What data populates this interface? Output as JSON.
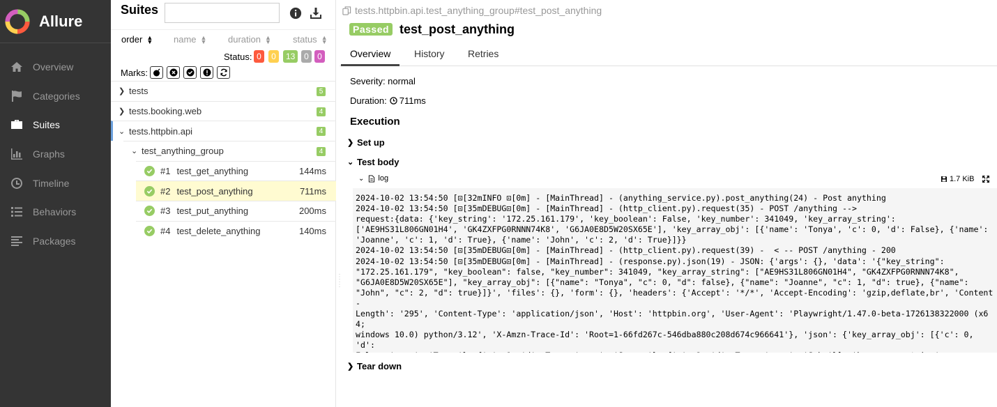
{
  "app": {
    "name": "Allure"
  },
  "nav": [
    {
      "label": "Overview",
      "icon": "home-icon"
    },
    {
      "label": "Categories",
      "icon": "flag-icon"
    },
    {
      "label": "Suites",
      "icon": "briefcase-icon",
      "active": true
    },
    {
      "label": "Graphs",
      "icon": "bar-chart-icon"
    },
    {
      "label": "Timeline",
      "icon": "clock-icon"
    },
    {
      "label": "Behaviors",
      "icon": "list-icon"
    },
    {
      "label": "Packages",
      "icon": "align-left-icon"
    }
  ],
  "tree": {
    "title": "Suites",
    "search": {
      "value": "",
      "placeholder": ""
    },
    "sort": {
      "order": "order",
      "name": "name",
      "duration": "duration",
      "status": "status"
    },
    "status_label": "Status:",
    "status_counts": [
      {
        "value": "0",
        "color": "#fd5a3e"
      },
      {
        "value": "0",
        "color": "#ffd050"
      },
      {
        "value": "13",
        "color": "#97cc64"
      },
      {
        "value": "0",
        "color": "#aaaaaa"
      },
      {
        "value": "0",
        "color": "#d35ebe"
      }
    ],
    "marks_label": "Marks:",
    "marks": [
      "bomb-icon",
      "times-circle-icon",
      "check-circle-icon",
      "info-circle-icon",
      "refresh-icon"
    ],
    "suites": [
      {
        "name": "tests",
        "count": "5"
      },
      {
        "name": "tests.booking.web",
        "count": "4"
      },
      {
        "name": "tests.httpbin.api",
        "count": "4"
      }
    ],
    "group": {
      "name": "test_anything_group",
      "count": "4"
    },
    "tests": [
      {
        "num": "#1",
        "name": "test_get_anything",
        "duration": "144ms"
      },
      {
        "num": "#2",
        "name": "test_post_anything",
        "duration": "711ms"
      },
      {
        "num": "#3",
        "name": "test_put_anything",
        "duration": "200ms"
      },
      {
        "num": "#4",
        "name": "test_delete_anything",
        "duration": "140ms"
      }
    ]
  },
  "detail": {
    "breadcrumb": "tests.httpbin.api.test_anything_group#test_post_anything",
    "status": "Passed",
    "title": "test_post_anything",
    "tabs": [
      "Overview",
      "History",
      "Retries"
    ],
    "severity": "Severity: normal",
    "duration_label": "Duration:",
    "duration_value": "711ms",
    "execution_title": "Execution",
    "setup": "Set up",
    "test_body": "Test body",
    "teardown": "Tear down",
    "log_name": "log",
    "log_size": "1.7 KiB",
    "log_text": "2024-10-02 13:54:50 [⊡[32mINFO ⊡[0m] - [MainThread] - (anything_service.py).post_anything(24) - Post anything\n2024-10-02 13:54:50 [⊡[35mDEBUG⊡[0m] - [MainThread] - (http_client.py).request(35) - POST /anything -->\nrequest:{data: {'key_string': '172.25.161.179', 'key_boolean': False, 'key_number': 341049, 'key_array_string':\n['AE9HS31L806GN01H4', 'GK4ZXFPG0RNNN74K8', 'G6JA0E8D5W20SX65E'], 'key_array_obj': [{'name': 'Tonya', 'c': 0, 'd': False}, {'name':\n'Joanne', 'c': 1, 'd': True}, {'name': 'John', 'c': 2, 'd': True}]}}\n2024-10-02 13:54:50 [⊡[35mDEBUG⊡[0m] - [MainThread] - (http_client.py).request(39) -  < -- POST /anything - 200\n2024-10-02 13:54:50 [⊡[35mDEBUG⊡[0m] - [MainThread] - (response.py).json(19) - JSON: {'args': {}, 'data': '{\"key_string\":\n\"172.25.161.179\", \"key_boolean\": false, \"key_number\": 341049, \"key_array_string\": [\"AE9HS31L806GN01H4\", \"GK4ZXFPG0RNNN74K8\",\n\"G6JA0E8D5W20SX65E\"], \"key_array_obj\": [{\"name\": \"Tonya\", \"c\": 0, \"d\": false}, {\"name\": \"Joanne\", \"c\": 1, \"d\": true}, {\"name\":\n\"John\", \"c\": 2, \"d\": true}]}', 'files': {}, 'form': {}, 'headers': {'Accept': '*/*', 'Accept-Encoding': 'gzip,deflate,br', 'Content-\nLength': '295', 'Content-Type': 'application/json', 'Host': 'httpbin.org', 'User-Agent': 'Playwright/1.47.0-beta-1726138322000 (x64;\nwindows 10.0) python/3.12', 'X-Amzn-Trace-Id': 'Root=1-66fd267c-546dba880c208d674c966641'}, 'json': {'key_array_obj': [{'c': 0, 'd':\nFalse, 'name': 'Tonya'}, {'c': 1, 'd': True, 'name': 'Joanne'}, {'c': 2, 'd': True, 'name': 'John'}], 'key_array_string':\n['AE9HS31L806GN01H4', 'GK4ZXFPG0RNNN74K8', 'G6JA0E8D5W20SX65E'], 'key_boolean': False, 'key_number': 341049, 'key_string':\n'172.25.161.179'}, 'method': 'POST', 'origin': '37.215.7.192', 'url': 'https://httpbin.org/anything'}"
  }
}
